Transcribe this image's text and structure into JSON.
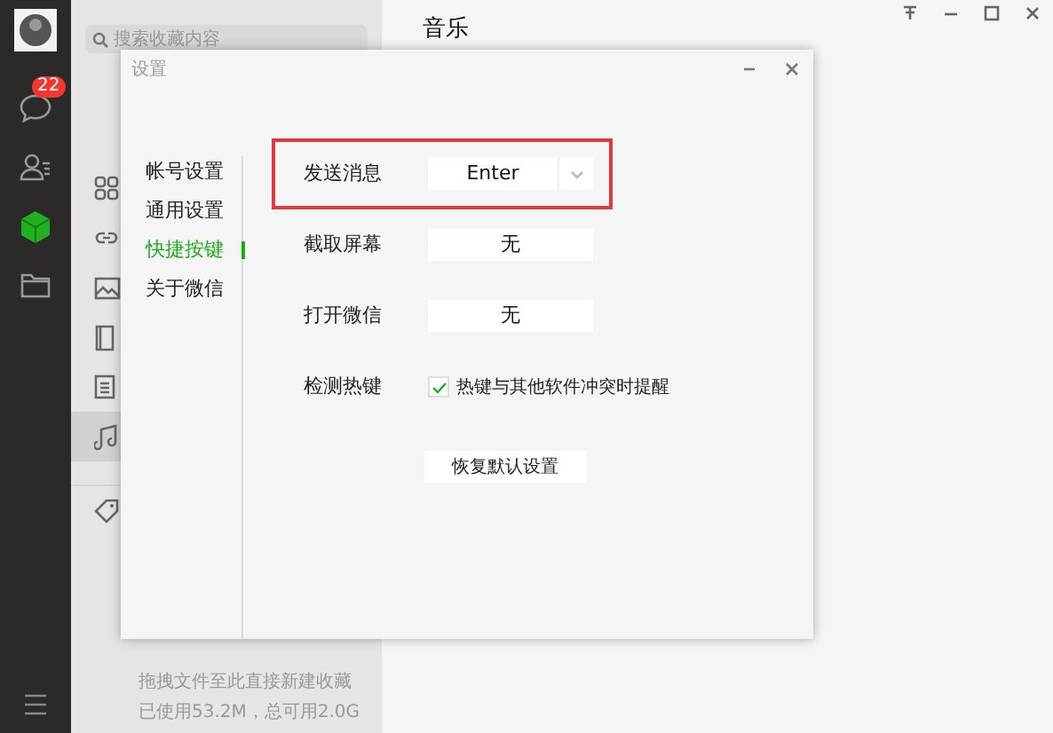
{
  "rail": {
    "badge": "22"
  },
  "collections": {
    "search_placeholder": "搜索收藏内容",
    "items": [
      {
        "selected": false
      },
      {
        "selected": false
      },
      {
        "selected": false
      },
      {
        "selected": false
      },
      {
        "selected": false
      },
      {
        "selected": true
      }
    ],
    "footer": [
      "拖拽文件至此直接新建收藏",
      "已使用53.2M，总可用2.0G"
    ]
  },
  "main": {
    "title": "音乐"
  },
  "dialog": {
    "title": "设置",
    "nav": [
      {
        "label": "帐号设置",
        "selected": false
      },
      {
        "label": "通用设置",
        "selected": false
      },
      {
        "label": "快捷按键",
        "selected": true
      },
      {
        "label": "关于微信",
        "selected": false
      }
    ],
    "shortcuts": [
      {
        "kind": "dropdown",
        "label": "发送消息",
        "value": "Enter",
        "highlighted": true
      },
      {
        "kind": "field",
        "label": "截取屏幕",
        "value": "无",
        "highlighted": false
      },
      {
        "kind": "field",
        "label": "打开微信",
        "value": "无",
        "highlighted": false
      },
      {
        "kind": "checkbox",
        "label": "检测热键",
        "value": "热键与其他软件冲突时提醒",
        "checked": true,
        "highlighted": false
      }
    ],
    "reset_button": "恢复默认设置"
  }
}
